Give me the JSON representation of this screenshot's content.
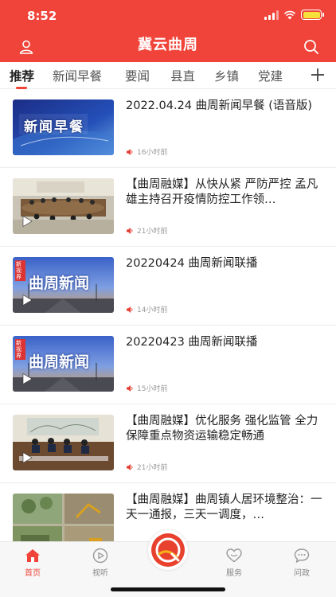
{
  "status_bar": {
    "time": "8:52"
  },
  "app": {
    "title": "冀云曲周",
    "accent": "#f0443a"
  },
  "tabs": [
    {
      "label": "推荐",
      "active": true
    },
    {
      "label": "新闻早餐"
    },
    {
      "label": "要闻"
    },
    {
      "label": "县直"
    },
    {
      "label": "乡镇"
    },
    {
      "label": "党建"
    }
  ],
  "news": [
    {
      "title": "2022.04.24 曲周新闻早餐 (语音版)",
      "time": "16小时前",
      "thumb_text": "新闻早餐",
      "has_play": false
    },
    {
      "title": "【曲周融媒】从快从紧 严防严控 孟凡雄主持召开疫情防控工作领…",
      "time": "21小时前",
      "has_play": true
    },
    {
      "title": "20220424 曲周新闻联播",
      "time": "14小时前",
      "thumb_text": "曲周新闻",
      "thumb_badge": "新视界",
      "has_play": true
    },
    {
      "title": "20220423 曲周新闻联播",
      "time": "15小时前",
      "thumb_text": "曲周新闻",
      "thumb_badge": "新视界",
      "has_play": true
    },
    {
      "title": "【曲周融媒】优化服务 强化监管 全力保障重点物资运输稳定畅通",
      "time": "21小时前",
      "has_play": true
    },
    {
      "title": "【曲周融媒】曲周镇人居环境整治：一天一通报，三天一调度，…",
      "time": "",
      "has_play": false
    }
  ],
  "bottom_nav": [
    {
      "label": "首页",
      "icon": "home-icon",
      "active": true
    },
    {
      "label": "视听",
      "icon": "play-circle-icon"
    },
    {
      "label": "",
      "icon": "app-logo-icon"
    },
    {
      "label": "服务",
      "icon": "heart-icon"
    },
    {
      "label": "问政",
      "icon": "chat-icon"
    }
  ]
}
